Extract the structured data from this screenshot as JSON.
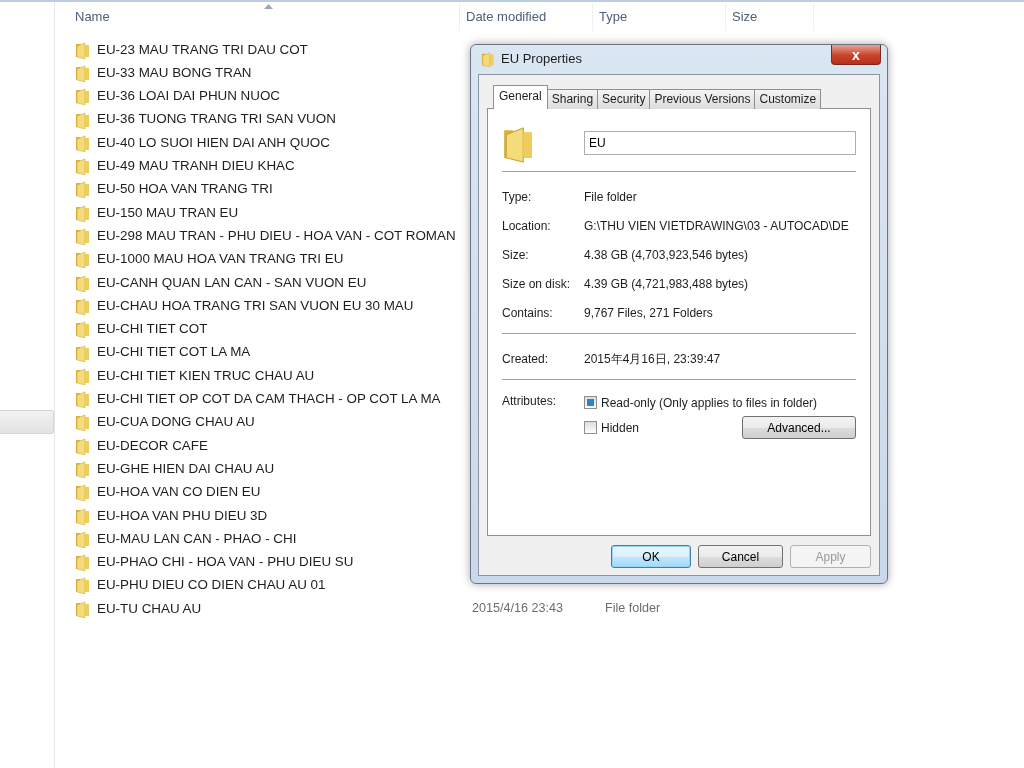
{
  "explorer": {
    "columns": [
      "Name",
      "Date modified",
      "Type",
      "Size"
    ],
    "rows": [
      {
        "name": "EU-23 MAU TRANG TRI DAU COT"
      },
      {
        "name": "EU-33 MAU BONG TRAN"
      },
      {
        "name": "EU-36 LOAI DAI PHUN NUOC"
      },
      {
        "name": "EU-36 TUONG TRANG TRI SAN VUON"
      },
      {
        "name": "EU-40 LO SUOI HIEN DAI ANH QUOC"
      },
      {
        "name": "EU-49 MAU TRANH DIEU KHAC"
      },
      {
        "name": "EU-50 HOA VAN TRANG TRI"
      },
      {
        "name": "EU-150 MAU TRAN EU"
      },
      {
        "name": "EU-298 MAU TRAN - PHU DIEU - HOA VAN - COT ROMAN"
      },
      {
        "name": "EU-1000 MAU HOA VAN TRANG TRI EU"
      },
      {
        "name": "EU-CANH QUAN LAN CAN - SAN VUON EU"
      },
      {
        "name": "EU-CHAU HOA TRANG TRI SAN VUON EU 30 MAU"
      },
      {
        "name": "EU-CHI TIET COT"
      },
      {
        "name": "EU-CHI TIET COT LA MA"
      },
      {
        "name": "EU-CHI TIET KIEN TRUC CHAU AU"
      },
      {
        "name": "EU-CHI TIET OP COT DA CAM THACH - OP COT LA MA"
      },
      {
        "name": "EU-CUA DONG CHAU AU"
      },
      {
        "name": "EU-DECOR CAFE"
      },
      {
        "name": "EU-GHE HIEN DAI CHAU AU"
      },
      {
        "name": "EU-HOA VAN CO DIEN EU"
      },
      {
        "name": "EU-HOA VAN PHU DIEU 3D"
      },
      {
        "name": "EU-MAU LAN CAN - PHAO - CHI"
      },
      {
        "name": "EU-PHAO CHI - HOA VAN - PHU DIEU SU"
      },
      {
        "name": "EU-PHU DIEU CO DIEN CHAU AU 01"
      },
      {
        "name": "EU-TU CHAU AU",
        "date": "2015/4/16 23:43",
        "type": "File folder"
      }
    ]
  },
  "dialog": {
    "title": "EU Properties",
    "close": "x",
    "tabs": [
      {
        "label": "General",
        "selected": true
      },
      {
        "label": "Sharing",
        "selected": false
      },
      {
        "label": "Security",
        "selected": false
      },
      {
        "label": "Previous Versions",
        "selected": false
      },
      {
        "label": "Customize",
        "selected": false
      }
    ],
    "name_field": {
      "value": "EU"
    },
    "groups": [
      [
        {
          "label": "Type:",
          "value": "File folder"
        },
        {
          "label": "Location:",
          "value": "G:\\THU VIEN VIETDRAWING\\03 - AUTOCAD\\DE"
        },
        {
          "label": "Size:",
          "value": "4.38 GB (4,703,923,546 bytes)"
        },
        {
          "label": "Size on disk:",
          "value": "4.39 GB (4,721,983,488 bytes)"
        },
        {
          "label": "Contains:",
          "value": "9,767 Files, 271 Folders"
        }
      ],
      [
        {
          "label": "Created:",
          "value": "2015年4月16日, 23:39:47"
        }
      ]
    ],
    "attributes": {
      "label": "Attributes:",
      "items": [
        {
          "label": "Read-only (Only applies to files in folder)",
          "checked": true
        },
        {
          "label": "Hidden",
          "checked": false
        }
      ],
      "advanced": "Advanced..."
    },
    "buttons": [
      {
        "label": "OK",
        "default": true,
        "disabled": false
      },
      {
        "label": "Cancel",
        "default": false,
        "disabled": false
      },
      {
        "label": "Apply",
        "default": false,
        "disabled": true
      }
    ]
  }
}
